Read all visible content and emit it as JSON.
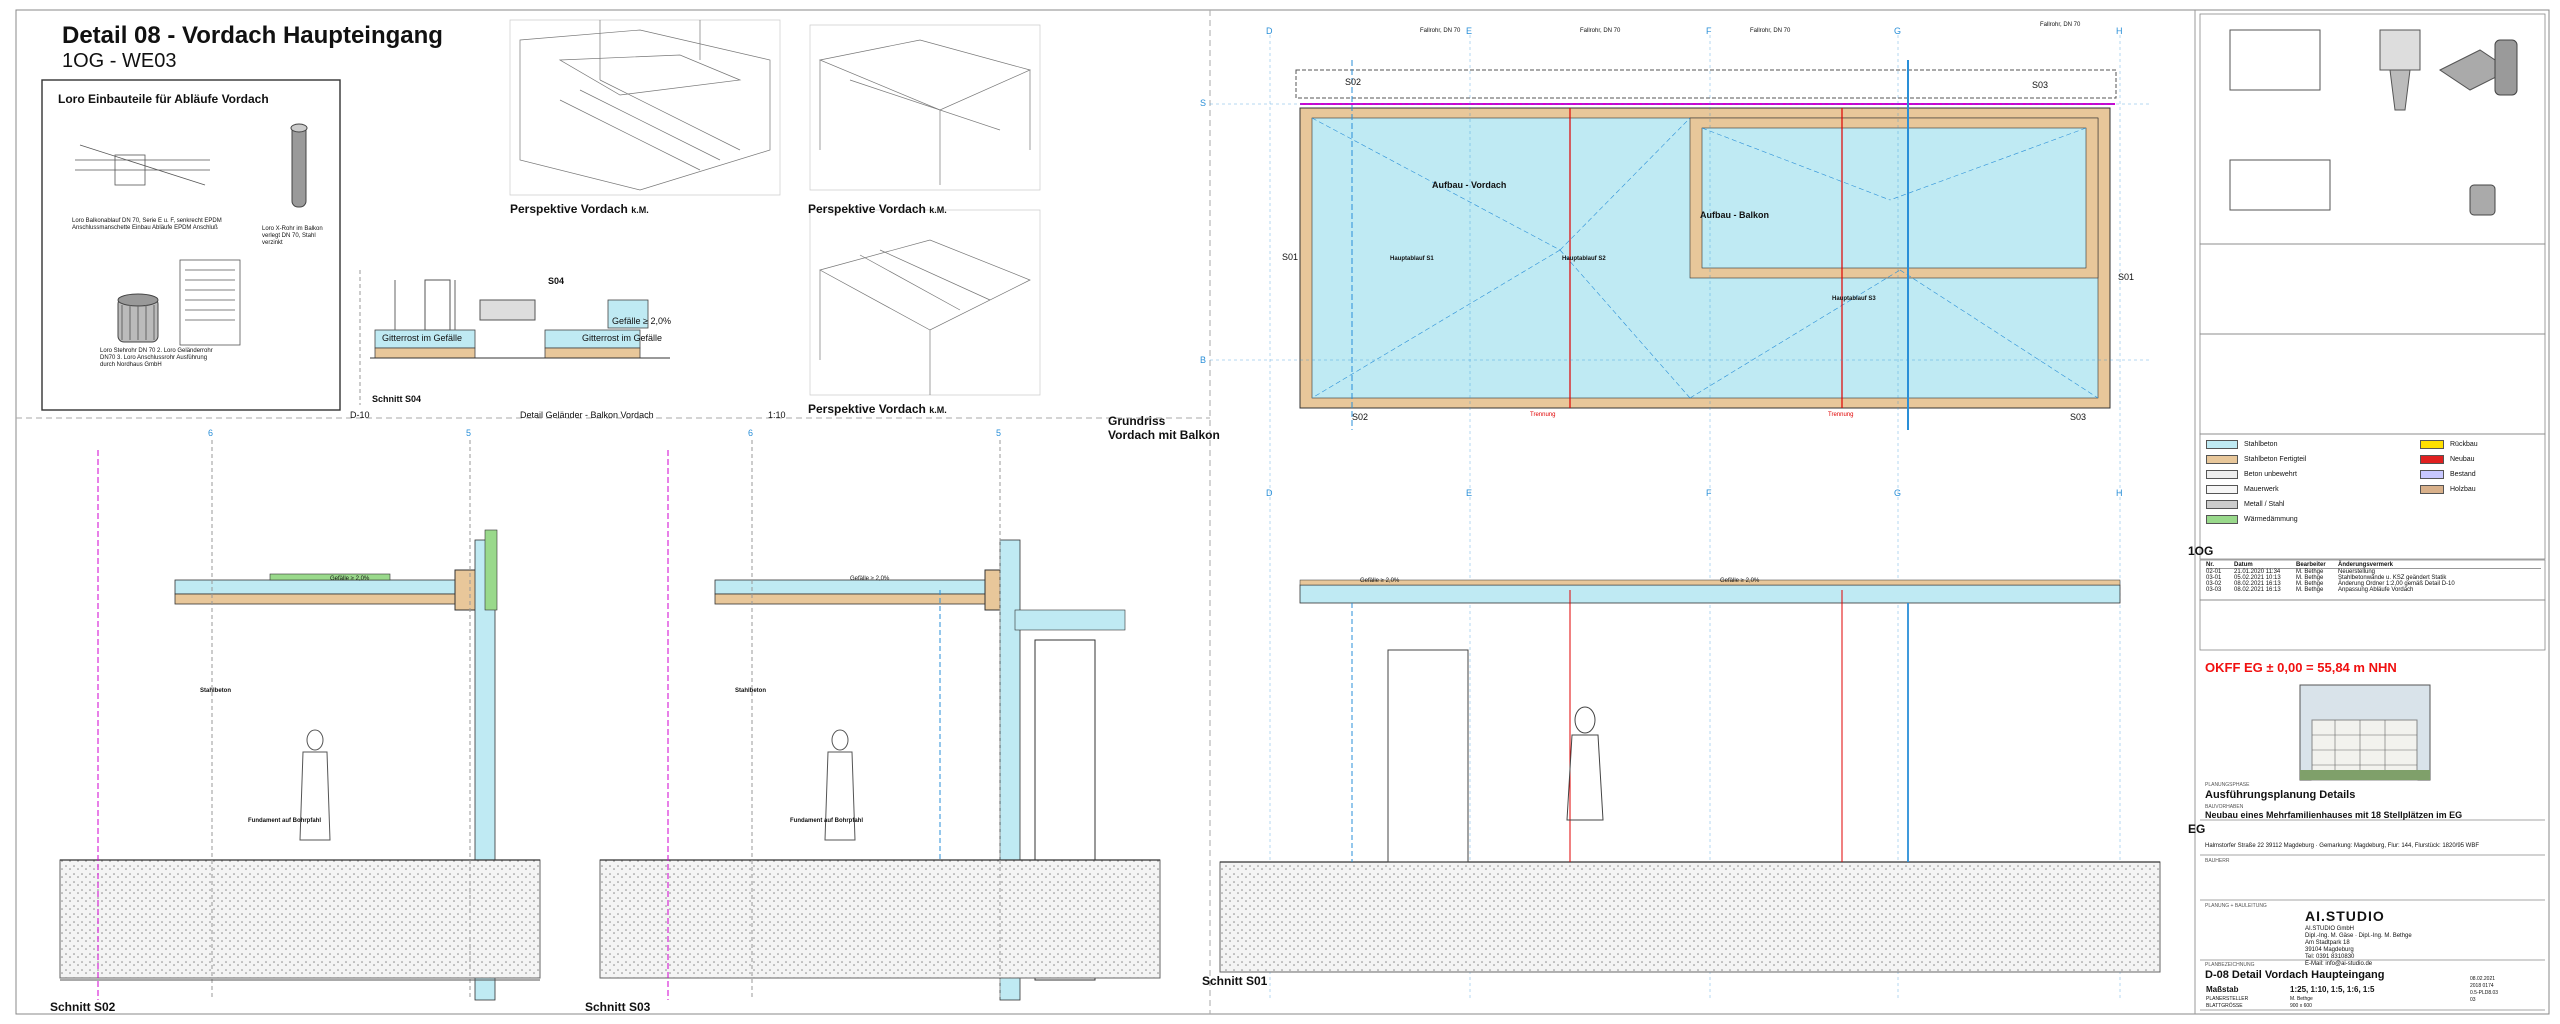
{
  "sheet": {
    "title": "Detail 08 - Vordach Haupteingang",
    "subtitle": "1OG - WE03"
  },
  "loro_panel": {
    "title": "Loro Einbauteile für Abläufe Vordach",
    "note1": "Loro Balkonablauf DN 70, Serie E u. F, senkrecht EPDM Anschlussmanschette Einbau Abläufe EPDM Anschluß",
    "note2": "Loro X-Rohr im Balkon verlegt DN 70, Stahl verzinkt",
    "note3": "Loro Stehrohr DN 70 2. Loro Geländerrohr DN70 3. Loro Anschlussrohr Ausführung durch Nordhaus GmbH"
  },
  "views": {
    "perspektive_1": "Perspektive Vordach",
    "perspektive_2": "Perspektive Vordach",
    "perspektive_3": "Perspektive Vordach",
    "km": "k.M.",
    "schnitt_s04": "Schnitt S04",
    "d10": "D-10",
    "detail_gelaender": "Detail Geländer - Balkon Vordach",
    "scale_110": "1:10",
    "grundriss_1": "Grundriss",
    "grundriss_2": "Vordach mit Balkon",
    "schnitt_s02": "Schnitt S02",
    "schnitt_s03": "Schnitt S03",
    "schnitt_s01": "Schnitt S01"
  },
  "s04_labels": {
    "gitterrost": "Gitterrost im Gefälle",
    "gefaelle": "Gefälle ≥ 2,0%",
    "s04": "S04"
  },
  "grid": {
    "plan_top": [
      "D",
      "E",
      "F",
      "G",
      "H"
    ],
    "plan_bottom": [
      "D",
      "E",
      "F",
      "G",
      "H"
    ],
    "side": [
      "S",
      "B"
    ],
    "section_axes": [
      "6",
      "5",
      "6",
      "5"
    ]
  },
  "plan_labels": {
    "aufbau_vordach": "Aufbau - Vordach",
    "aufbau_balkon": "Aufbau - Balkon",
    "s01": "S01",
    "s02": "S02",
    "s03": "S03",
    "hauptablauf_1": "Hauptablauf S1",
    "hauptablauf_2": "Hauptablauf S2",
    "hauptablauf_3": "Hauptablauf S3",
    "trennung": "Trennung",
    "fallrohr": "Fallrohr, DN 70"
  },
  "section_labels": {
    "level_1og": "1OG",
    "level_eg": "EG",
    "gefaelle": "Gefälle ≥ 2,0%",
    "stahlbeton": "Stahlbeton",
    "fundament": "Fundament auf Bohrpfahl"
  },
  "legend": {
    "stahlbeton": "Stahlbeton",
    "stahlbeton_fertigteil": "Stahlbeton Fertigteil",
    "beton_unbewehrt": "Beton unbewehrt",
    "mauerwerk": "Mauerwerk",
    "metall_stahl": "Metall / Stahl",
    "waermedaemmung": "Wärmedämmung",
    "holz": "Holzbau",
    "neubau": "Neubau",
    "bestand": "Bestand",
    "rueckbau": "Rückbau"
  },
  "revisions": {
    "headers": [
      "Nr.",
      "Datum",
      "Bearbeiter",
      "Änderungsvermerk"
    ],
    "rows": [
      [
        "02-01",
        "21.01.2020 11:34",
        "M. Bethge",
        "Neuerstellung"
      ],
      [
        "03-01",
        "05.02.2021 10:13",
        "M. Bethge",
        "Stahlbetonwände u. KSZ geändert Statik"
      ],
      [
        "03-02",
        "08.02.2021 16:13",
        "M. Bethge",
        "Änderung Ordner 1:2,00 gemäß Detail D-10"
      ],
      [
        "03-03",
        "08.02.2021 16:13",
        "M. Bethge",
        "Anpassung Abläufe Vordach"
      ]
    ]
  },
  "titleblock": {
    "okff": "OKFF EG ± 0,00 = 55,84 m NHN",
    "phase_label": "PLANUNGSPHASE",
    "phase": "Ausführungsplanung Details",
    "project_label": "BAUVORHABEN",
    "project": "Neubau eines Mehrfamilienhauses mit 18 Stellplätzen im EG",
    "address": "Halmstorfer Straße 22 39112 Magdeburg · Gemarkung: Magdeburg, Flur: 144, Flurstück: 1820/95 WBF",
    "client_label": "BAUHERR",
    "planner_label": "PLANUNG + BAULEITUNG",
    "studio": "AI.STUDIO",
    "studio_line1": "AI.STUDIO GmbH",
    "studio_line2": "Dipl.-Ing. M. Gäse · Dipl.-Ing. M. Bethge",
    "studio_line3": "Am Stadtpark 18",
    "studio_line4": "39104 Magdeburg",
    "studio_line5": "Tel: 0391 8310830",
    "studio_line6": "E-Mail: info@ai-studio.de",
    "drawing_label": "PLANBEZEICHNUNG",
    "drawing": "D-08 Detail Vordach Haupteingang",
    "scale_label": "Maßstab",
    "scale": "1:25, 1:10, 1:5, 1:6, 1:5",
    "planverfasser_label": "PLANERSTELLER",
    "planverfasser": "M. Bethge",
    "blattgroesse_label": "BLATTGRÖSSE",
    "blattgroesse": "900 x 600",
    "date": "08.02.2021",
    "plan_nr": "2018 0174",
    "plan_id": "0.5-PLD8.03",
    "plan_index": "03"
  },
  "colors": {
    "water": "#bfeaf3",
    "concrete": "#e8c79a",
    "insulation": "#99d98b",
    "red_line": "#e00000",
    "blue_line": "#2a8fd8",
    "magenta": "#d000d0"
  }
}
